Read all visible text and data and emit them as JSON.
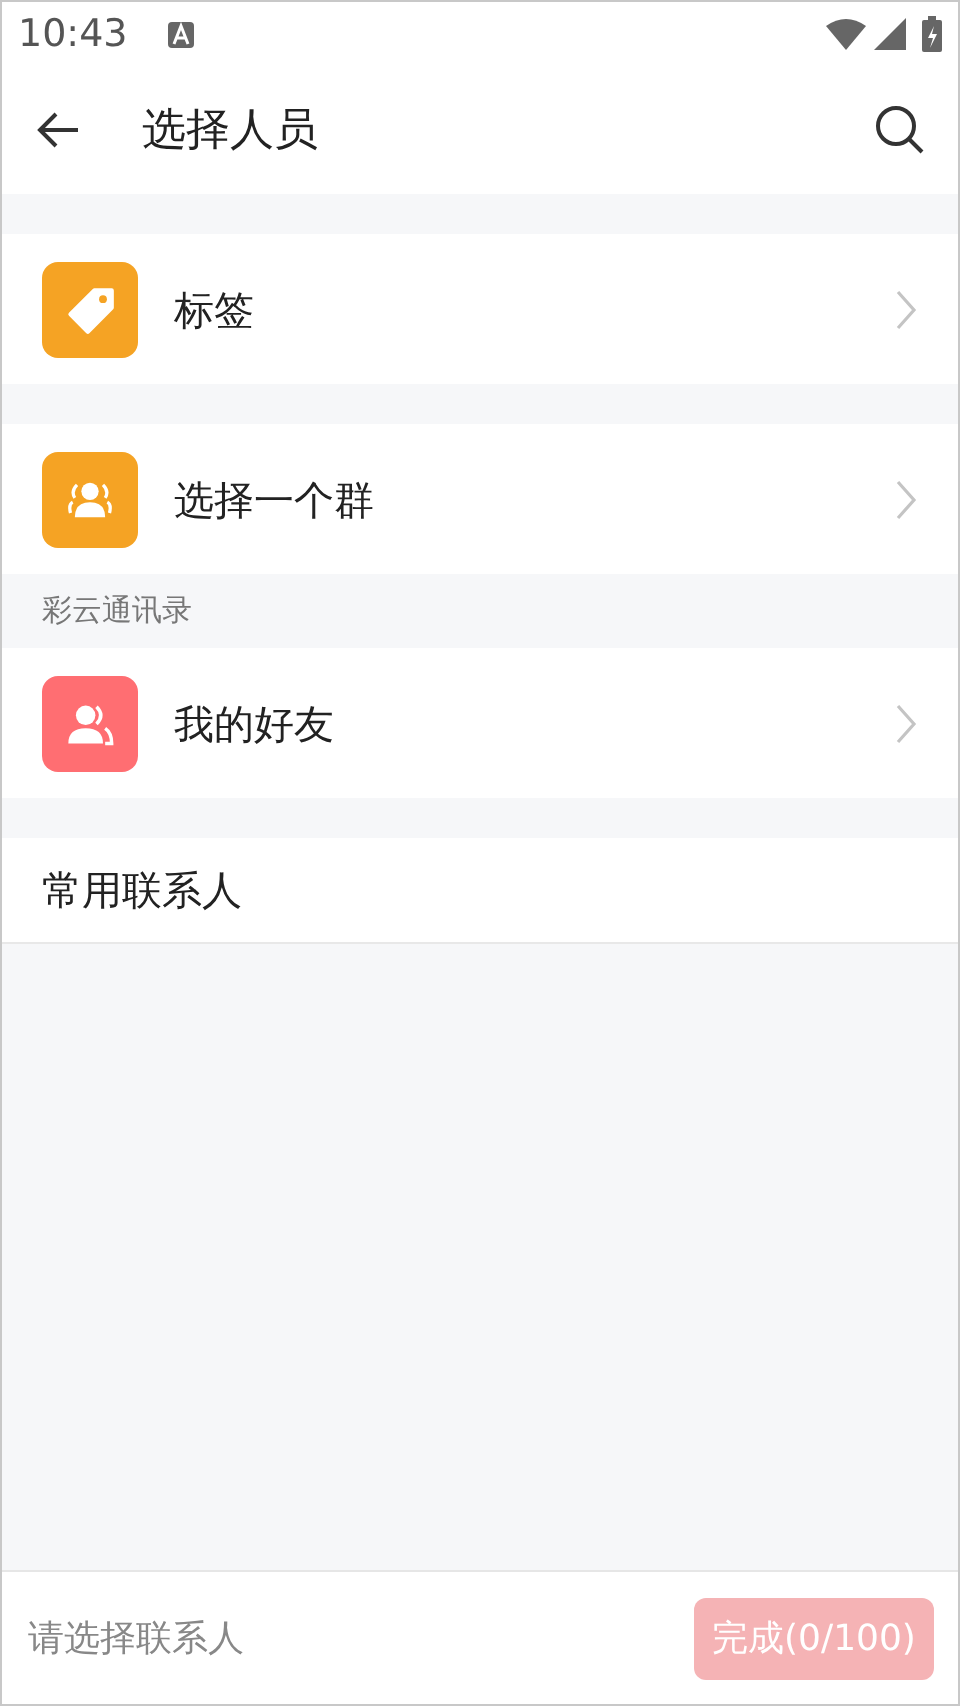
{
  "status_bar": {
    "time": "10:43"
  },
  "header": {
    "title": "选择人员"
  },
  "groups": [
    {
      "items": [
        {
          "kind": "tag",
          "label": "标签",
          "color": "#f5a324"
        }
      ]
    },
    {
      "items": [
        {
          "kind": "group",
          "label": "选择一个群",
          "color": "#f5a324"
        }
      ]
    },
    {
      "header": "彩云通讯录",
      "items": [
        {
          "kind": "friends",
          "label": "我的好友",
          "color": "#ff6e72"
        }
      ]
    }
  ],
  "recent": {
    "title": "常用联系人"
  },
  "footer": {
    "hint": "请选择联系人",
    "confirm": {
      "label": "完成(0/100)",
      "disabled": true
    }
  }
}
